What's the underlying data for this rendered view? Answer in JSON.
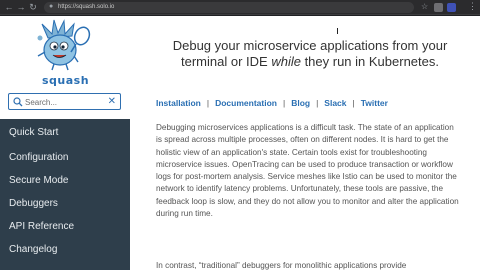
{
  "browser": {
    "url": "https://squash.solo.io"
  },
  "sidebar": {
    "logo_text": "squash",
    "search": {
      "placeholder": "Search...",
      "value": ""
    },
    "items": [
      {
        "label": "Quick Start"
      },
      {
        "label": "Configuration"
      },
      {
        "label": "Secure Mode"
      },
      {
        "label": "Debuggers"
      },
      {
        "label": "API Reference"
      },
      {
        "label": "Changelog"
      }
    ]
  },
  "main": {
    "heading_before": "Debug your microservice applications from your terminal or IDE ",
    "heading_em": "while",
    "heading_after": " they run in Kubernetes.",
    "links": [
      {
        "label": "Installation"
      },
      {
        "label": "Documentation"
      },
      {
        "label": "Blog"
      },
      {
        "label": "Slack"
      },
      {
        "label": "Twitter"
      }
    ],
    "paragraph": "Debugging microservices applications is a difficult task. The state of an application is spread across multiple processes, often on different nodes. It is hard to get the holistic view of an application's state. Certain tools exist for troubleshooting microservice issues. OpenTracing can be used to produce transaction or workflow logs for post-mortem analysis. Service meshes like Istio can be used to monitor the network to identify latency problems. Unfortunately, these tools are passive, the feedback loop is slow, and they do not allow you to monitor and alter the application during run time.",
    "paragraph2": "In contrast, “traditional” debuggers for monolithic applications provide"
  },
  "colors": {
    "sidebar_nav_bg": "#2e3e4b",
    "accent": "#2a6fb3"
  }
}
